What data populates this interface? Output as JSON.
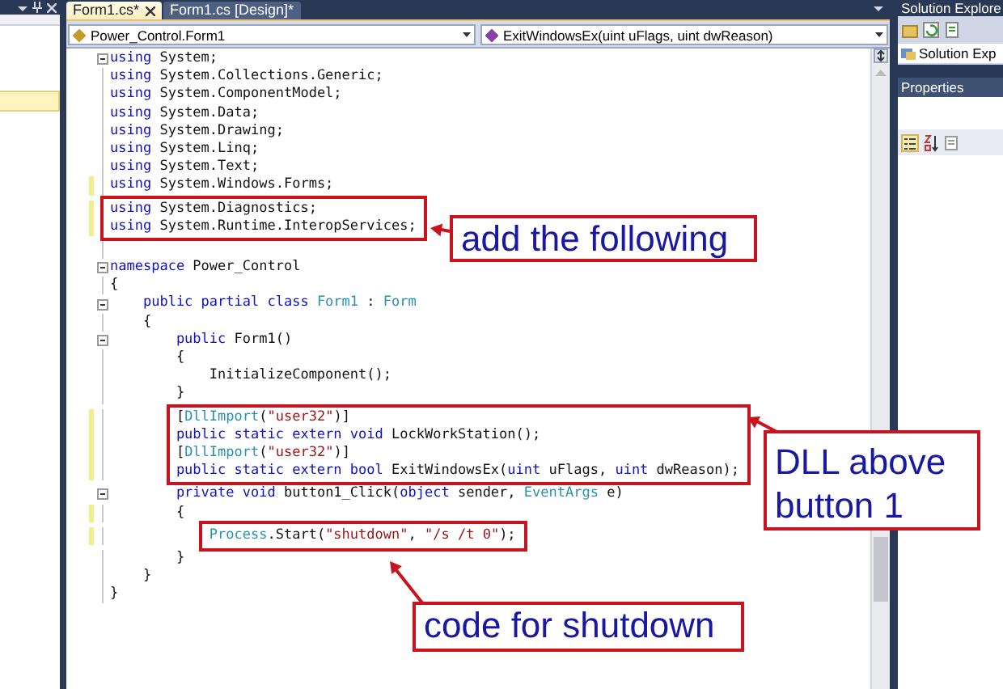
{
  "tabs": [
    {
      "label": "Form1.cs*",
      "selected": true,
      "closable": true
    },
    {
      "label": "Form1.cs [Design]*",
      "selected": false,
      "closable": false
    }
  ],
  "navigation_bar": {
    "type_dropdown": "Power_Control.Form1",
    "member_dropdown": "ExitWindowsEx(uint uFlags, uint dwReason)"
  },
  "code_lines": [
    {
      "tokens": [
        {
          "kind": "keyword",
          "text": "using"
        },
        {
          "kind": "text",
          "text": " System;"
        }
      ],
      "foldable": true,
      "changed": false,
      "boxed": false
    },
    {
      "tokens": [
        {
          "kind": "keyword",
          "text": "using"
        },
        {
          "kind": "text",
          "text": " System.Collections.Generic;"
        }
      ],
      "foldable": false,
      "changed": false,
      "boxed": false
    },
    {
      "tokens": [
        {
          "kind": "keyword",
          "text": "using"
        },
        {
          "kind": "text",
          "text": " System.ComponentModel;"
        }
      ],
      "foldable": false,
      "changed": false,
      "boxed": false
    },
    {
      "tokens": [
        {
          "kind": "keyword",
          "text": "using"
        },
        {
          "kind": "text",
          "text": " System.Data;"
        }
      ],
      "foldable": false,
      "changed": false,
      "boxed": false
    },
    {
      "tokens": [
        {
          "kind": "keyword",
          "text": "using"
        },
        {
          "kind": "text",
          "text": " System.Drawing;"
        }
      ],
      "foldable": false,
      "changed": false,
      "boxed": false
    },
    {
      "tokens": [
        {
          "kind": "keyword",
          "text": "using"
        },
        {
          "kind": "text",
          "text": " System.Linq;"
        }
      ],
      "foldable": false,
      "changed": false,
      "boxed": false
    },
    {
      "tokens": [
        {
          "kind": "keyword",
          "text": "using"
        },
        {
          "kind": "text",
          "text": " System.Text;"
        }
      ],
      "foldable": false,
      "changed": false,
      "boxed": false
    },
    {
      "tokens": [
        {
          "kind": "keyword",
          "text": "using"
        },
        {
          "kind": "text",
          "text": " System.Windows.Forms;"
        }
      ],
      "foldable": false,
      "changed": true,
      "boxed": false
    },
    {
      "tokens": [
        {
          "kind": "keyword",
          "text": "using"
        },
        {
          "kind": "text",
          "text": " System.Diagnostics;"
        }
      ],
      "foldable": false,
      "changed": true,
      "boxed": true
    },
    {
      "tokens": [
        {
          "kind": "keyword",
          "text": "using"
        },
        {
          "kind": "text",
          "text": " System.Runtime.InteropServices;"
        }
      ],
      "foldable": false,
      "changed": true,
      "boxed": true
    },
    {
      "foldable": false,
      "changed": false,
      "boxed": false
    },
    {
      "tokens": [
        {
          "kind": "keyword",
          "text": "namespace"
        },
        {
          "kind": "text",
          "text": " Power_Control"
        }
      ],
      "foldable": true,
      "changed": false,
      "boxed": false
    },
    {
      "tokens": [
        {
          "kind": "text",
          "text": "{"
        }
      ],
      "foldable": false,
      "changed": false,
      "boxed": false
    },
    {
      "tokens": [
        {
          "kind": "keyword",
          "text": "    public partial class "
        },
        {
          "kind": "type",
          "text": "Form1"
        },
        {
          "kind": "text",
          "text": " : "
        },
        {
          "kind": "type",
          "text": "Form"
        }
      ],
      "foldable": true,
      "changed": false,
      "boxed": false
    },
    {
      "tokens": [
        {
          "kind": "text",
          "text": "    {"
        }
      ],
      "foldable": false,
      "changed": false,
      "boxed": false
    },
    {
      "tokens": [
        {
          "kind": "keyword",
          "text": "        public"
        },
        {
          "kind": "text",
          "text": " Form1()"
        }
      ],
      "foldable": true,
      "changed": false,
      "boxed": false
    },
    {
      "tokens": [
        {
          "kind": "text",
          "text": "        {"
        }
      ],
      "foldable": false,
      "changed": false,
      "boxed": false
    },
    {
      "tokens": [
        {
          "kind": "text",
          "text": "            InitializeComponent();"
        }
      ],
      "foldable": false,
      "changed": false,
      "boxed": false
    },
    {
      "tokens": [
        {
          "kind": "text",
          "text": "        }"
        }
      ],
      "foldable": false,
      "changed": false,
      "boxed": false
    },
    {
      "tokens": [
        {
          "kind": "text",
          "text": "        ["
        },
        {
          "kind": "type",
          "text": "DllImport"
        },
        {
          "kind": "text",
          "text": "("
        },
        {
          "kind": "string",
          "text": "\"user32\""
        },
        {
          "kind": "text",
          "text": ")]"
        }
      ],
      "foldable": false,
      "changed": true,
      "boxed": true
    },
    {
      "tokens": [
        {
          "kind": "keyword",
          "text": "        public static extern void"
        },
        {
          "kind": "text",
          "text": " LockWorkStation();"
        }
      ],
      "foldable": false,
      "changed": true,
      "boxed": true
    },
    {
      "tokens": [
        {
          "kind": "text",
          "text": "        ["
        },
        {
          "kind": "type",
          "text": "DllImport"
        },
        {
          "kind": "text",
          "text": "("
        },
        {
          "kind": "string",
          "text": "\"user32\""
        },
        {
          "kind": "text",
          "text": ")]"
        }
      ],
      "foldable": false,
      "changed": true,
      "boxed": true
    },
    {
      "tokens": [
        {
          "kind": "keyword",
          "text": "        public static extern bool"
        },
        {
          "kind": "text",
          "text": " ExitWindowsEx("
        },
        {
          "kind": "keyword",
          "text": "uint"
        },
        {
          "kind": "text",
          "text": " uFlags, "
        },
        {
          "kind": "keyword",
          "text": "uint"
        },
        {
          "kind": "text",
          "text": " dwReason);"
        }
      ],
      "foldable": false,
      "changed": true,
      "boxed": true
    },
    {
      "tokens": [
        {
          "kind": "keyword",
          "text": "        private void"
        },
        {
          "kind": "text",
          "text": " button1_Click("
        },
        {
          "kind": "keyword",
          "text": "object"
        },
        {
          "kind": "text",
          "text": " sender, "
        },
        {
          "kind": "type",
          "text": "EventArgs"
        },
        {
          "kind": "text",
          "text": " e)"
        }
      ],
      "foldable": true,
      "changed": false,
      "boxed": false
    },
    {
      "tokens": [
        {
          "kind": "text",
          "text": "        {"
        }
      ],
      "foldable": false,
      "changed": true,
      "boxed": false
    },
    {
      "tokens": [
        {
          "kind": "type",
          "text": "            Process"
        },
        {
          "kind": "text",
          "text": ".Start("
        },
        {
          "kind": "string",
          "text": "\"shutdown\""
        },
        {
          "kind": "text",
          "text": ", "
        },
        {
          "kind": "string",
          "text": "\"/s /t 0\""
        },
        {
          "kind": "text",
          "text": ");"
        }
      ],
      "foldable": false,
      "changed": true,
      "boxed": true
    },
    {
      "tokens": [
        {
          "kind": "text",
          "text": "        }"
        }
      ],
      "foldable": false,
      "changed": false,
      "boxed": false
    },
    {
      "tokens": [
        {
          "kind": "text",
          "text": "    }"
        }
      ],
      "foldable": false,
      "changed": false,
      "boxed": false
    },
    {
      "tokens": [
        {
          "kind": "text",
          "text": "}"
        }
      ],
      "foldable": false,
      "changed": false,
      "boxed": false
    }
  ],
  "annotations": [
    {
      "text": "add the following"
    },
    {
      "text": "DLL above button 1"
    },
    {
      "text": "code for shutdown"
    }
  ],
  "solution_explorer": {
    "title": "Solution Explore",
    "tab": "Solution Exp"
  },
  "properties": {
    "title": "Properties"
  }
}
